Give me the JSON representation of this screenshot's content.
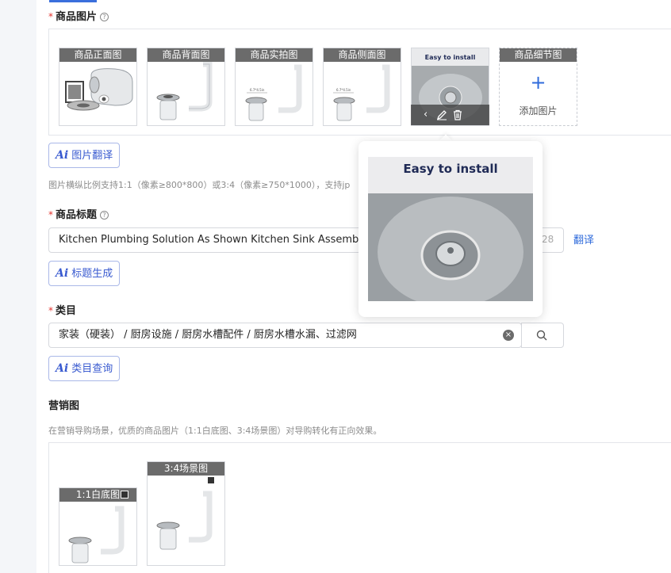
{
  "product_images": {
    "label": "商品图片",
    "required_mark": "*",
    "help_icon": "question-circle-icon",
    "thumbs": [
      {
        "caption": "商品正面图"
      },
      {
        "caption": "商品背面图"
      },
      {
        "caption": "商品实拍图"
      },
      {
        "caption": "商品侧面图"
      },
      {
        "caption": "Easy to install"
      },
      {
        "caption": "商品细节图"
      }
    ],
    "add_label": "添加图片",
    "add_icon": "plus-icon",
    "ai_button": {
      "ai": "Ai",
      "label": "图片翻译"
    },
    "hint": "图片横纵比例支持1:1（像素≥800*800）或3:4（像素≥750*1000），支持jp"
  },
  "preview_popup": {
    "caption": "Easy to install",
    "prev_icon": "chevron-left-icon",
    "edit_icon": "pencil-icon",
    "delete_icon": "trash-icon"
  },
  "title_field": {
    "label": "商品标题",
    "required_mark": "*",
    "value": "Kitchen Plumbing Solution As Shown Kitchen Sink Assembly N",
    "count": "28",
    "translate_link": "翻译",
    "ai_button": {
      "ai": "Ai",
      "label": "标题生成"
    }
  },
  "category_field": {
    "label": "类目",
    "required_mark": "*",
    "value": "家装（硬装） / 厨房设施 / 厨房水槽配件 / 厨房水槽水漏、过滤网",
    "clear_icon": "clear-circle-icon",
    "search_icon": "search-icon",
    "ai_button": {
      "ai": "Ai",
      "label": "类目查询"
    }
  },
  "marketing": {
    "label": "营销图",
    "hint": "在营销导购场景，优质的商品图片（1:1白底图、3:4场景图）对导购转化有正向效果。",
    "thumbs": [
      {
        "caption": "1:1白底图"
      },
      {
        "caption": "3:4场景图"
      }
    ]
  },
  "colors": {
    "accent": "#2f6bdb",
    "required": "#e3342f",
    "caption_bg": "#6b6b6b"
  }
}
